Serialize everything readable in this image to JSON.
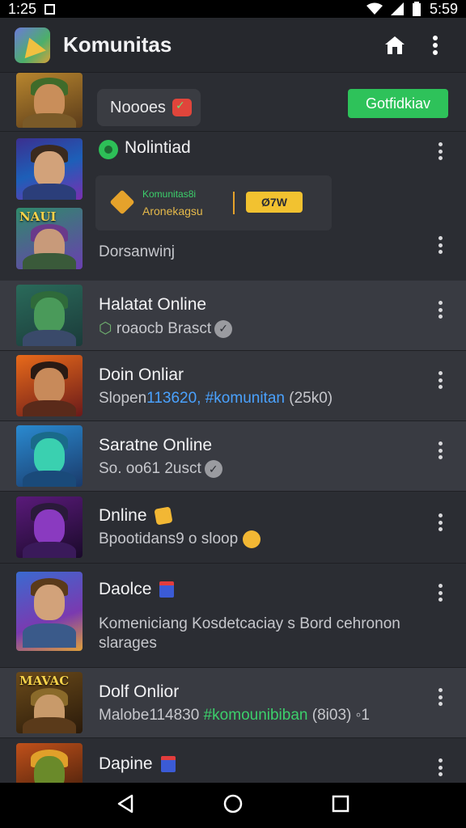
{
  "status_bar": {
    "time": "1:25",
    "right_time": "5:59"
  },
  "app_bar": {
    "title": "Komunitas"
  },
  "top_row": {
    "pill_label": "Noooes",
    "button_label": "Gotfidkiav"
  },
  "notif_row": {
    "title": "Nolintiad",
    "card_line1": "Komunitas8i",
    "card_line2": "Aronekagsu",
    "card_chip": "Ø7W",
    "subtitle": "Dorsanwinj"
  },
  "rows": [
    {
      "title": "Halatat Online",
      "sub": "roaocb Brasct"
    },
    {
      "title": "Doin Onliar",
      "sub_prefix": "Slopen",
      "sub_number": "113620, ",
      "sub_tag": "#komunitan",
      "sub_suffix": " (25k0)"
    },
    {
      "title": "Saratne Online",
      "sub": "So. oo61 2usct"
    },
    {
      "title": "Dnline",
      "sub": "Bpootidans9 o sloop"
    },
    {
      "title": "Daolce",
      "sub_line1": "Komeniciang Kosdetcaciay s Bord cehronon",
      "sub_line2": "slarages"
    },
    {
      "title": "Dolf Onlior",
      "sub_prefix": "Malobe",
      "sub_number": "114830 ",
      "sub_tag": "#komounibiban",
      "sub_suffix": " (8i03) ◦1"
    },
    {
      "title": "Dapine"
    }
  ],
  "avatar_tags": {
    "notif_second": "NAUI",
    "row6": "MAVAC"
  },
  "colors": {
    "accent_green": "#2ec25a",
    "link_blue": "#4aa2ff",
    "background": "#2b2d33"
  }
}
